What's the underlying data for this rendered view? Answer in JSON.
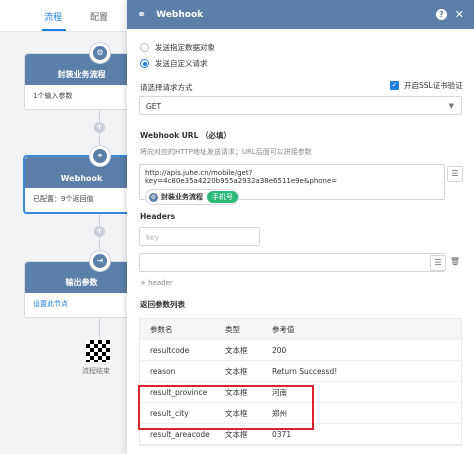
{
  "flow": {
    "tabs": [
      {
        "label": "流程",
        "active": true
      },
      {
        "label": "配置",
        "active": false
      }
    ],
    "nodes": [
      {
        "title": "封装业务流程",
        "body": "1个输入参数",
        "icon": "cube-cluster-icon"
      },
      {
        "title": "Webhook",
        "body": "已配置：9个返回值",
        "icon": "webhook-icon"
      },
      {
        "title": "输出参数",
        "body": "设置此节点",
        "icon": "output-icon"
      }
    ],
    "end_label": "流程结束"
  },
  "panel": {
    "title": "Webhook",
    "help": "?",
    "close": "✕",
    "radios": [
      {
        "label": "发送指定数据对象",
        "selected": false
      },
      {
        "label": "发送自定义请求",
        "selected": true
      }
    ],
    "method_label": "请选择请求方式",
    "ssl_label": "开启SSL证书验证",
    "method_value": "GET",
    "url_label": "Webhook URL （必填）",
    "url_hint": "将向对应的HTTP地址发送请求；URL后面可以拼接参数",
    "url_value": "http://apis.juhe.cn/mobile/get?key=4c80e35a4220b955a2932a38e6511e9e&phone=",
    "chip_name": "封装业务流程",
    "chip_tag": "手机号",
    "headers_label": "Headers",
    "key_placeholder": "key",
    "add_header": "+ header",
    "return_label": "返回参数列表",
    "table": {
      "headers": [
        "参数名",
        "类型",
        "参考值"
      ],
      "rows": [
        [
          "resultcode",
          "文本框",
          "200"
        ],
        [
          "reason",
          "文本框",
          "Return Successd!"
        ],
        [
          "result_province",
          "文本框",
          "河南"
        ],
        [
          "result_city",
          "文本框",
          "郑州"
        ],
        [
          "result_areacode",
          "文本框",
          "0371"
        ]
      ]
    }
  },
  "colors": {
    "accent": "#1f7fe0",
    "header": "#5b7fa8",
    "chip_tag": "#2cb978",
    "highlight": "#d9232e"
  }
}
